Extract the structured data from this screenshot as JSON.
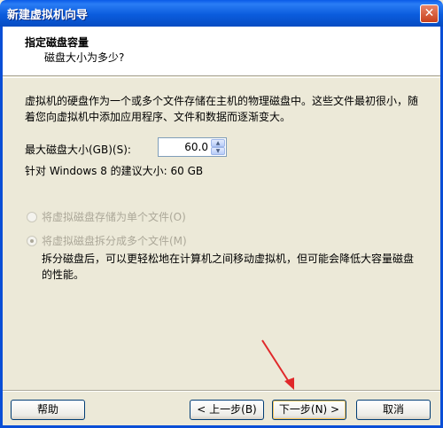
{
  "window": {
    "title": "新建虚拟机向导",
    "close_glyph": "✕"
  },
  "header": {
    "title": "指定磁盘容量",
    "subtitle": "磁盘大小为多少?"
  },
  "description": "虚拟机的硬盘作为一个或多个文件存储在主机的物理磁盘中。这些文件最初很小，随着您向虚拟机中添加应用程序、文件和数据而逐渐变大。",
  "max_disk": {
    "label": "最大磁盘大小(GB)(S):",
    "value": "60.0"
  },
  "recommendation": "针对 Windows 8 的建议大小: 60 GB",
  "options": [
    {
      "label": "将虚拟磁盘存储为单个文件(O)",
      "checked": false
    },
    {
      "label": "将虚拟磁盘拆分成多个文件(M)",
      "checked": true
    }
  ],
  "split_note": "拆分磁盘后，可以更轻松地在计算机之间移动虚拟机，但可能会降低大容量磁盘的性能。",
  "buttons": {
    "help": "帮助",
    "back": "< 上一步(B)",
    "next": "下一步(N) >",
    "cancel": "取消"
  },
  "colors": {
    "titlebar": "#0A5BE8",
    "arrow": "#E0282A"
  }
}
